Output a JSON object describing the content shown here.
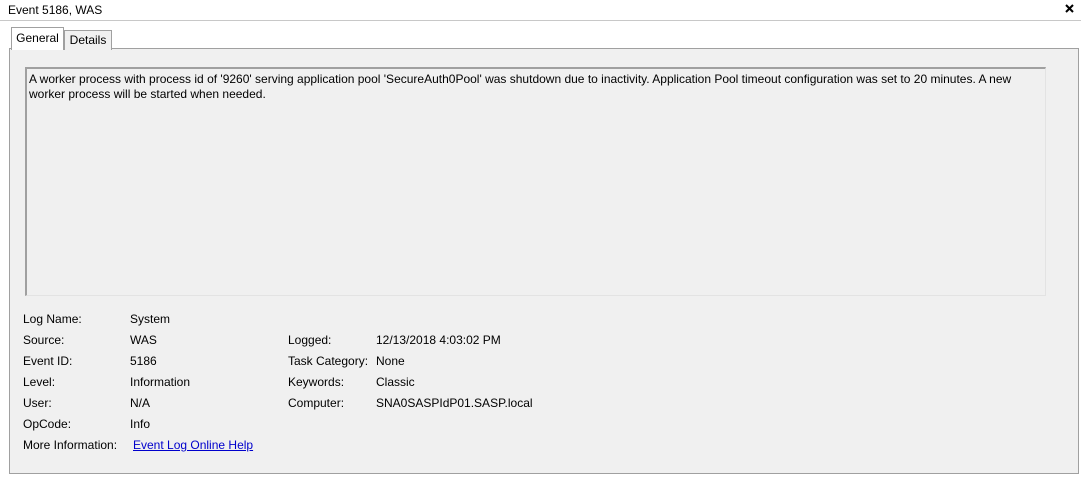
{
  "window": {
    "title": "Event 5186, WAS",
    "close_icon": "close-icon"
  },
  "tabs": [
    {
      "label": "General",
      "active": true
    },
    {
      "label": "Details",
      "active": false
    }
  ],
  "description": "A worker process with process id of '9260' serving application pool 'SecureAuth0Pool' was shutdown due to inactivity.  Application Pool timeout configuration was set to 20 minutes.  A new worker process will be started when needed.",
  "fields": {
    "log_name": {
      "label": "Log Name:",
      "value": "System"
    },
    "source": {
      "label": "Source:",
      "value": "WAS"
    },
    "event_id": {
      "label": "Event ID:",
      "value": "5186"
    },
    "level": {
      "label": "Level:",
      "value": "Information"
    },
    "user": {
      "label": "User:",
      "value": "N/A"
    },
    "opcode": {
      "label": "OpCode:",
      "value": "Info"
    },
    "more_info": {
      "label": "More Information:",
      "value": "Event Log Online Help"
    },
    "logged": {
      "label": "Logged:",
      "value": "12/13/2018 4:03:02 PM"
    },
    "task_category": {
      "label": "Task Category:",
      "value": "None"
    },
    "keywords": {
      "label": "Keywords:",
      "value": "Classic"
    },
    "computer": {
      "label": "Computer:",
      "value": "SNA0SASPIdP01.SASP.local"
    }
  },
  "colors": {
    "panel_bg": "#f0f0f0",
    "link": "#0000cc",
    "border": "#a0a0a0"
  }
}
